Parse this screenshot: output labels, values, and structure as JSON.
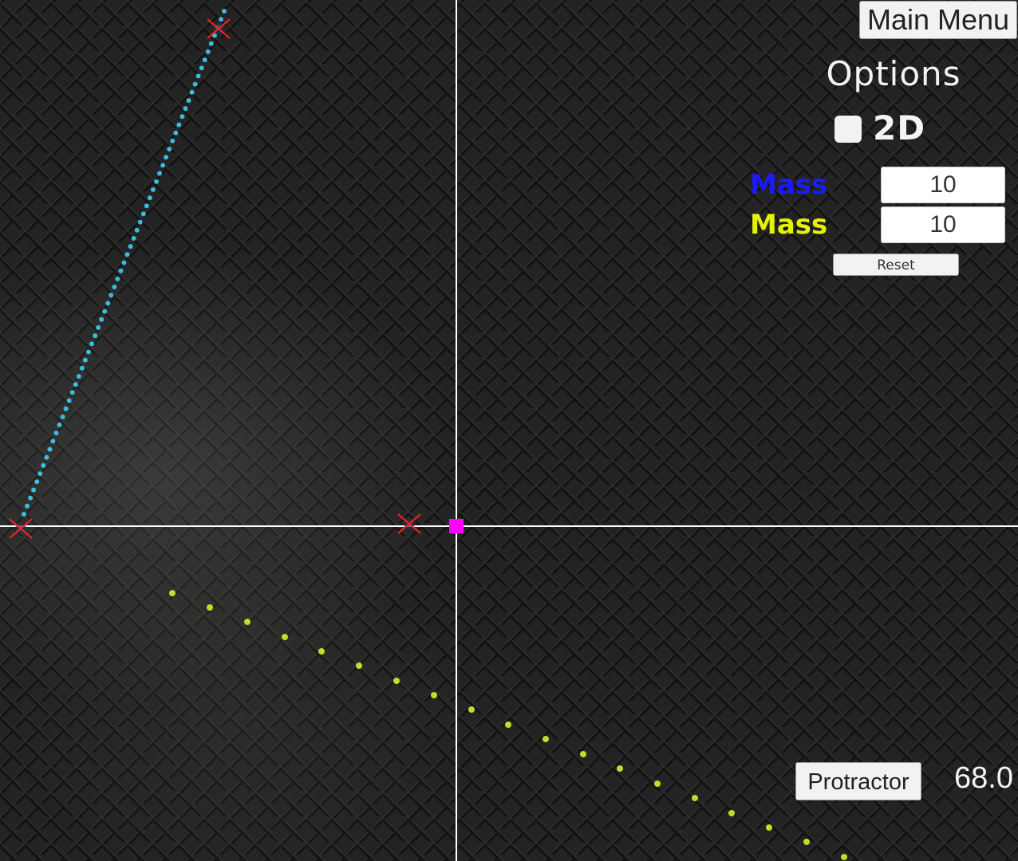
{
  "menu": {
    "main_menu_label": "Main Menu"
  },
  "options": {
    "title": "Options",
    "toggle_2d_label": "2D",
    "toggle_2d_checked": false,
    "masses": [
      {
        "label": "Mass",
        "color": "#1a1aff",
        "value": "10"
      },
      {
        "label": "Mass",
        "color": "#e6f000",
        "value": "10"
      }
    ],
    "reset_label": "Reset"
  },
  "protractor": {
    "button_label": "Protractor",
    "angle_value": "68.0"
  },
  "colors": {
    "axis": "#ffffff",
    "origin_marker": "#ff00ff",
    "trail_blue": "#3fd6ff",
    "trail_yellow": "#c8d92a",
    "marker_x": "#ff2020"
  }
}
